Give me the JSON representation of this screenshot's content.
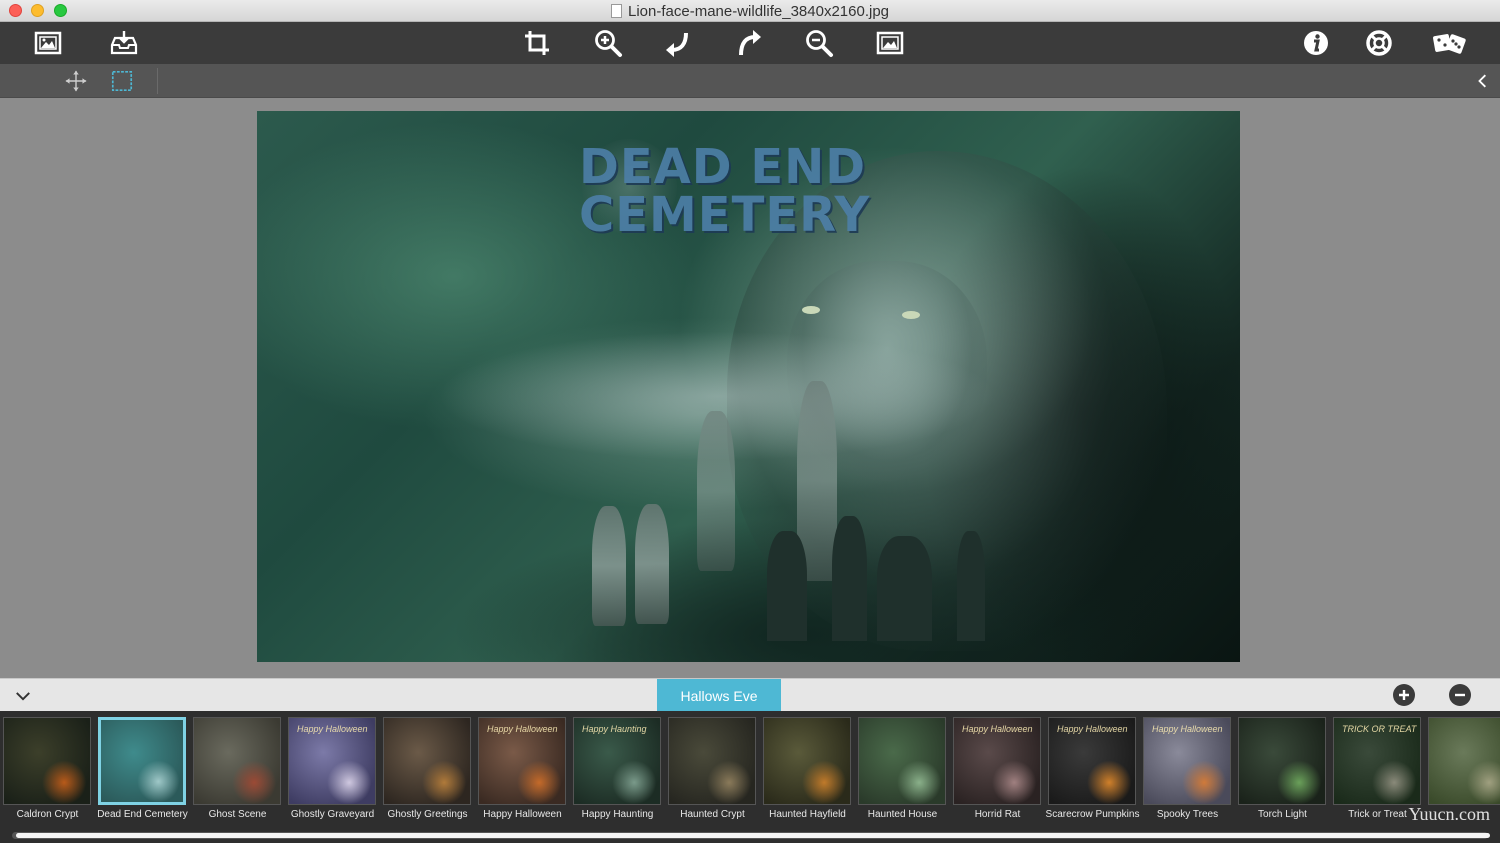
{
  "window": {
    "title": "Lion-face-mane-wildlife_3840x2160.jpg"
  },
  "toolbar": {
    "left": [
      {
        "name": "open-image-button",
        "icon": "picture-frame-icon"
      },
      {
        "name": "export-button",
        "icon": "tray-download-icon"
      }
    ],
    "center": [
      {
        "name": "crop-button",
        "icon": "crop-icon"
      },
      {
        "name": "zoom-in-button",
        "icon": "zoom-in-icon"
      },
      {
        "name": "rotate-left-button",
        "icon": "rotate-left-icon"
      },
      {
        "name": "rotate-right-button",
        "icon": "rotate-right-icon"
      },
      {
        "name": "zoom-out-button",
        "icon": "zoom-out-icon"
      },
      {
        "name": "fit-image-button",
        "icon": "fit-image-icon"
      }
    ],
    "right": [
      {
        "name": "info-button",
        "icon": "info-icon"
      },
      {
        "name": "help-button",
        "icon": "lifebuoy-icon"
      },
      {
        "name": "randomize-button",
        "icon": "dice-icon"
      }
    ]
  },
  "subbar": {
    "tools": [
      {
        "name": "move-tool",
        "icon": "move-arrows-icon"
      },
      {
        "name": "select-tool",
        "icon": "selection-rect-icon"
      }
    ]
  },
  "poster": {
    "line1": "DEAD END",
    "line2": "CEMETERY"
  },
  "collection": {
    "active_tab": "Hallows Eve"
  },
  "thumbnails": [
    {
      "label": "Caldron Crypt",
      "colors": [
        "#3c3f2a",
        "#1a2018",
        "#b85a1a"
      ]
    },
    {
      "label": "Dead End Cemetery",
      "colors": [
        "#3f8b8c",
        "#2b5a5a",
        "#9fc8c8"
      ],
      "selected": true
    },
    {
      "label": "Ghost Scene",
      "colors": [
        "#6a6a5e",
        "#3b3a32",
        "#9b4a35"
      ]
    },
    {
      "label": "Ghostly Graveyard",
      "colors": [
        "#7c7aa8",
        "#3e3c62",
        "#cfc8e0"
      ],
      "mini": "Happy Halloween"
    },
    {
      "label": "Ghostly Greetings",
      "colors": [
        "#6b5a48",
        "#2d2620",
        "#b07a3a"
      ]
    },
    {
      "label": "Happy Halloween",
      "colors": [
        "#7a5a48",
        "#3a2a22",
        "#c46a2a"
      ],
      "mini": "Happy Halloween"
    },
    {
      "label": "Happy Haunting",
      "colors": [
        "#3a5a4a",
        "#1c2c24",
        "#7a9a8a"
      ],
      "mini": "Happy Haunting"
    },
    {
      "label": "Haunted Crypt",
      "colors": [
        "#4a4a3a",
        "#262620",
        "#8a7a5a"
      ]
    },
    {
      "label": "Haunted Hayfield",
      "colors": [
        "#5a5a3a",
        "#2a2a1a",
        "#c07a2a"
      ]
    },
    {
      "label": "Haunted House",
      "colors": [
        "#4a6a4a",
        "#2a3a2a",
        "#8ab08a"
      ]
    },
    {
      "label": "Horrid Rat",
      "colors": [
        "#5a4a4a",
        "#2a2222",
        "#a08080"
      ],
      "mini": "Happy Halloween"
    },
    {
      "label": "Scarecrow Pumpkins",
      "colors": [
        "#3a3a3a",
        "#1a1a1a",
        "#d0802a"
      ],
      "mini": "Happy Halloween"
    },
    {
      "label": "Spooky Trees",
      "colors": [
        "#8a8a9a",
        "#4a4a5a",
        "#d07a3a"
      ],
      "mini": "Happy Halloween"
    },
    {
      "label": "Torch Light",
      "colors": [
        "#3a4a3a",
        "#1a221a",
        "#6aa05a"
      ]
    },
    {
      "label": "Trick or Treat",
      "colors": [
        "#3a4a3a",
        "#1a2a1a",
        "#8a8a7a"
      ],
      "mini": "TRICK OR TREAT"
    },
    {
      "label": "",
      "colors": [
        "#6a7a5a",
        "#3a4a2a",
        "#a0a080"
      ]
    }
  ],
  "watermark": "Yuucn.com"
}
